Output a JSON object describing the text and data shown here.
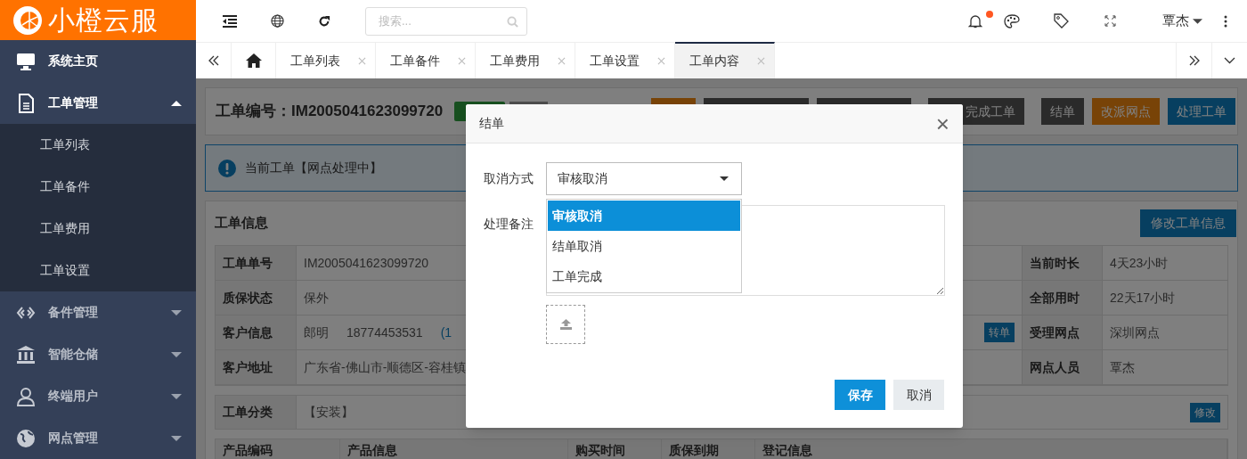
{
  "logo": {
    "text": "小橙云服"
  },
  "sidebar": {
    "items": [
      {
        "label": "系统主页",
        "selected": true
      },
      {
        "label": "工单管理",
        "selected": true,
        "expanded": true,
        "children": [
          {
            "label": "工单列表"
          },
          {
            "label": "工单备件"
          },
          {
            "label": "工单费用"
          },
          {
            "label": "工单设置"
          }
        ]
      },
      {
        "label": "备件管理",
        "selected": false,
        "expanded": false
      },
      {
        "label": "智能仓储",
        "selected": false,
        "expanded": false
      },
      {
        "label": "终端用户",
        "selected": false,
        "expanded": false
      },
      {
        "label": "网点管理",
        "selected": false,
        "expanded": false
      }
    ]
  },
  "topbar": {
    "search": {
      "placeholder": "搜索..."
    },
    "notification_dot": true,
    "user": "覃杰"
  },
  "tabs": [
    {
      "label": "工单列表",
      "selected": false
    },
    {
      "label": "工单备件",
      "selected": false
    },
    {
      "label": "工单费用",
      "selected": false
    },
    {
      "label": "工单设置",
      "selected": false
    },
    {
      "label": "工单内容",
      "selected": true
    }
  ],
  "page": {
    "title": "工单编号：IM2005041623099720",
    "header_buttons": [
      {
        "label": "完成工单",
        "kind": "default"
      },
      {
        "label": "结单",
        "kind": "default"
      },
      {
        "label": "改派网点",
        "kind": "warning"
      },
      {
        "label": "处理工单",
        "kind": "primary"
      }
    ],
    "alert": "当前工单【网点处理中】",
    "section_title": "工单信息",
    "edit_button": "修改工单信息",
    "info_rows": [
      {
        "label": "工单单号",
        "value": "IM2005041623099720",
        "right_label": "当前时长",
        "right_value": "4天23小时"
      },
      {
        "label": "质保状态",
        "value": "保外",
        "right_label": "全部用时",
        "right_value": "22天17小时"
      },
      {
        "label": "客户信息",
        "value": "郎明",
        "phone": "18774453531",
        "extra": "(1",
        "action": "转单",
        "right_label": "受理网点",
        "right_value": "深圳网点"
      },
      {
        "label": "客户地址",
        "value": "广东省-佛山市-顺德区-容桂镇",
        "right_label": "网点人员",
        "right_value": "覃杰"
      }
    ],
    "category": {
      "label": "工单分类",
      "value": "【安装】",
      "action": "修改"
    },
    "product_columns": [
      "产品编码",
      "产品信息",
      "购买时间",
      "质保到期",
      "登记信息"
    ]
  },
  "dialog": {
    "title": "结单",
    "close": "×",
    "cancel_mode": {
      "label": "取消方式",
      "value": "审核取消",
      "expanded": true,
      "options": [
        {
          "label": "审核取消",
          "selected": true
        },
        {
          "label": "结单取消",
          "selected": false
        },
        {
          "label": "工单完成",
          "selected": false
        }
      ]
    },
    "remark": {
      "label": "处理备注"
    },
    "buttons": [
      {
        "label": "保存",
        "kind": "primary"
      },
      {
        "label": "取消",
        "kind": "secondary"
      }
    ]
  }
}
